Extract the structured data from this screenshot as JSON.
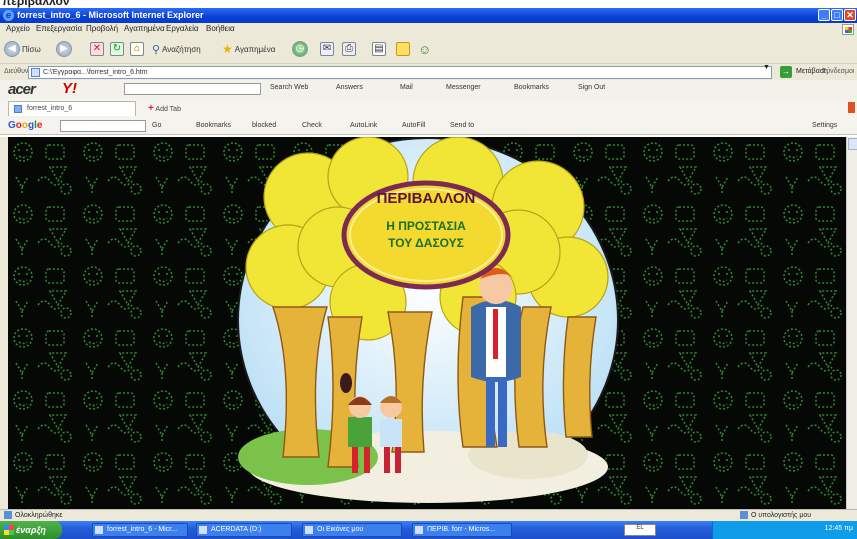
{
  "caption": "περιβάλλον",
  "window": {
    "title": "forrest_intro_6 - Microsoft Internet Explorer"
  },
  "menu": [
    "Αρχείο",
    "Επεξεργασία",
    "Προβολή",
    "Αγαπημένα",
    "Εργαλεία",
    "Βοήθεια"
  ],
  "toolbar": {
    "back": "Πίσω",
    "search": "Αναζήτηση",
    "favorites": "Αγαπημένα"
  },
  "address": {
    "label": "Διεύθυνση",
    "url": "C:\\Έγγραφα...\\forrest_intro_6.htm",
    "go": "Μετάβαση",
    "links": "Σύνδεσμοι"
  },
  "yahoo": {
    "brand": "acer",
    "logo": "Y!",
    "items": [
      "Search Web",
      "Answers",
      "Mail",
      "Messenger",
      "Bookmarks",
      "Sign Out"
    ]
  },
  "tabs": {
    "active": "forrest_intro_6",
    "add": "Add Tab"
  },
  "google": {
    "items": [
      "Go",
      "Bookmarks",
      "blocked",
      "Check",
      "AutoLink",
      "AutoFill",
      "Send to"
    ],
    "settings": "Settings"
  },
  "page": {
    "title": "ΠΕΡΙΒΑΛΛΟΝ",
    "subtitle_line1": "Η ΠΡΟΣΤΑΣΙΑ",
    "subtitle_line2": "ΤΟΥ ΔΑΣΟΥΣ"
  },
  "status": {
    "left": "Ολοκληρώθηκε",
    "right": "Ο υπολογιστής μου"
  },
  "taskbar": {
    "start": "έναρξη",
    "tasks": [
      "forrest_intro_6 - Micr...",
      "ACERDATA (D:)",
      "Οι Εικόνες μου",
      "ΠΕΡΙΒ. forr - Micros..."
    ],
    "lang": "EL",
    "clock": "12:45 πμ"
  },
  "colors": {
    "ellipse_fill": "#f4d92e",
    "ellipse_ring": "#7a2a55",
    "title_text": "#5a1440",
    "subtitle_text": "#1b6f2a",
    "bg_chalk": "#2f8a2f"
  }
}
